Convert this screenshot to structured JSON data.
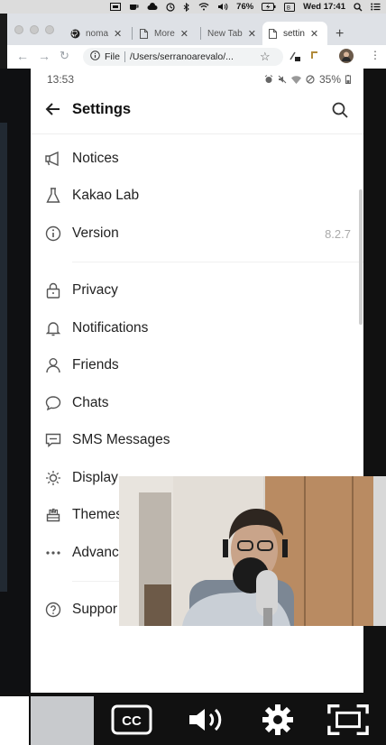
{
  "menubar": {
    "battery": "76%",
    "clock": "Wed 17:41"
  },
  "browser": {
    "tabs": [
      {
        "label": "noma",
        "icon": "github-icon"
      },
      {
        "label": "More",
        "icon": "page-icon"
      },
      {
        "label": "New Tab",
        "icon": ""
      },
      {
        "label": "settin",
        "icon": "page-icon"
      }
    ],
    "newtab_label": "+",
    "omnibox": {
      "scheme_label": "File",
      "url": "/Users/serranoarevalo/..."
    }
  },
  "phone": {
    "status_time": "13:53",
    "battery": "35%",
    "title": "Settings",
    "sections": [
      [
        {
          "label": "Notices",
          "icon": "megaphone-icon",
          "value": ""
        },
        {
          "label": "Kakao Lab",
          "icon": "flask-icon",
          "value": ""
        },
        {
          "label": "Version",
          "icon": "info-icon",
          "value": "8.2.7"
        }
      ],
      [
        {
          "label": "Privacy",
          "icon": "lock-icon",
          "value": ""
        },
        {
          "label": "Notifications",
          "icon": "bell-icon",
          "value": ""
        },
        {
          "label": "Friends",
          "icon": "person-icon",
          "value": ""
        },
        {
          "label": "Chats",
          "icon": "chat-bubble-icon",
          "value": ""
        },
        {
          "label": "SMS Messages",
          "icon": "sms-icon",
          "value": ""
        },
        {
          "label": "Display",
          "icon": "sun-icon",
          "value": ""
        },
        {
          "label": "Themes",
          "icon": "brush-icon",
          "value": ""
        },
        {
          "label": "Advanc",
          "icon": "more-dots-icon",
          "value": ""
        }
      ],
      [
        {
          "label": "Suppor",
          "icon": "help-icon",
          "value": ""
        }
      ]
    ]
  },
  "video_controls": [
    "captions-icon",
    "volume-icon",
    "settings-gear-icon",
    "fullscreen-icon"
  ]
}
